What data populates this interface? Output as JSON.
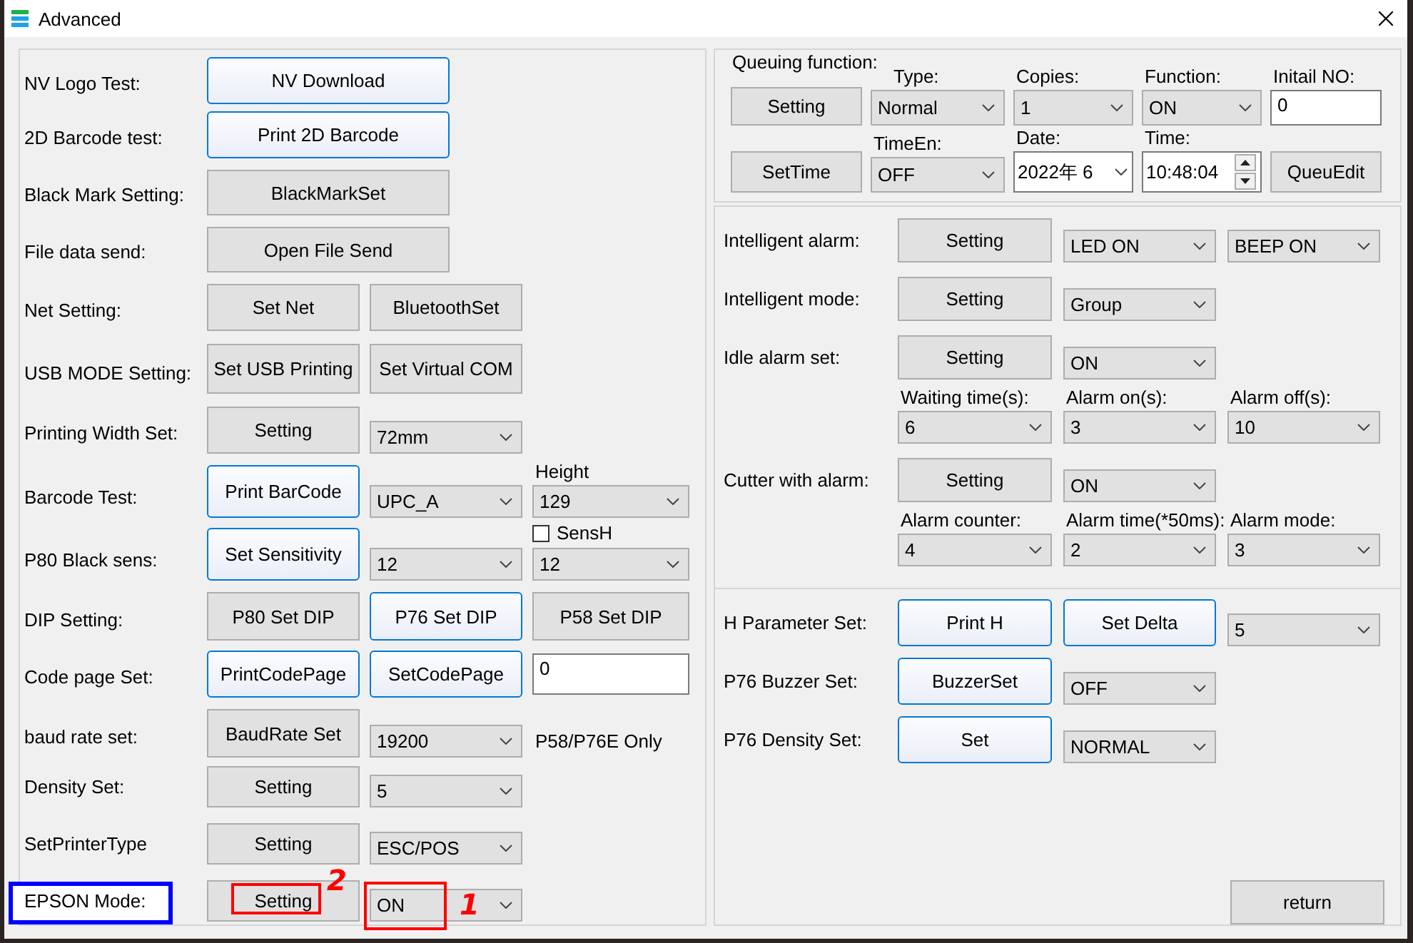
{
  "window": {
    "title": "Advanced"
  },
  "left_panel": {
    "rows": [
      {
        "label": "NV Logo Test:",
        "controls": [
          {
            "kind": "button",
            "label": "NV Download",
            "highlighted": true
          }
        ]
      },
      {
        "label": "2D Barcode test:",
        "controls": [
          {
            "kind": "button",
            "label": "Print 2D Barcode",
            "highlighted": true
          }
        ]
      },
      {
        "label": "Black Mark Setting:",
        "controls": [
          {
            "kind": "button",
            "label": "BlackMarkSet",
            "highlighted": false
          }
        ]
      },
      {
        "label": "File data send:",
        "controls": [
          {
            "kind": "button",
            "label": "Open File Send",
            "highlighted": false
          }
        ]
      },
      {
        "label": "Net Setting:",
        "controls": [
          {
            "kind": "button",
            "label": "Set Net",
            "highlighted": false
          },
          {
            "kind": "button",
            "label": "BluetoothSet",
            "highlighted": false
          }
        ]
      },
      {
        "label": "USB MODE Setting:",
        "controls": [
          {
            "kind": "button",
            "label": "Set USB Printing",
            "highlighted": false
          },
          {
            "kind": "button",
            "label": "Set Virtual COM",
            "highlighted": false
          }
        ]
      },
      {
        "label": "Printing Width Set:",
        "controls": [
          {
            "kind": "button",
            "label": "Setting",
            "highlighted": false
          },
          {
            "kind": "select",
            "value": "72mm"
          }
        ]
      },
      {
        "label": "Barcode Test:",
        "controls": [
          {
            "kind": "button",
            "label": "Print BarCode",
            "highlighted": true
          },
          {
            "kind": "select",
            "value": "UPC_A"
          },
          {
            "kind": "select",
            "caption": "Height",
            "value": "129"
          }
        ]
      },
      {
        "label": "P80 Black sens:",
        "controls": [
          {
            "kind": "button",
            "label": "Set Sensitivity",
            "highlighted": true
          },
          {
            "kind": "select",
            "value": "12"
          },
          {
            "kind": "select",
            "checkbox": {
              "label": "SensH",
              "checked": false
            },
            "value": "12"
          }
        ]
      },
      {
        "label": "DIP Setting:",
        "controls": [
          {
            "kind": "button",
            "label": "P80 Set DIP",
            "highlighted": false
          },
          {
            "kind": "button",
            "label": "P76 Set DIP",
            "highlighted": true
          },
          {
            "kind": "button",
            "label": "P58 Set DIP",
            "highlighted": false
          }
        ]
      },
      {
        "label": "Code page Set:",
        "controls": [
          {
            "kind": "button",
            "label": "PrintCodePage",
            "highlighted": true
          },
          {
            "kind": "button",
            "label": "SetCodePage",
            "highlighted": true
          },
          {
            "kind": "input",
            "value": "0"
          }
        ]
      },
      {
        "label": "baud rate set:",
        "controls": [
          {
            "kind": "button",
            "label": "BaudRate Set",
            "highlighted": false
          },
          {
            "kind": "select",
            "value": "19200"
          },
          {
            "kind": "note",
            "text": "P58/P76E Only"
          }
        ]
      },
      {
        "label": "Density Set:",
        "controls": [
          {
            "kind": "button",
            "label": "Setting",
            "highlighted": false
          },
          {
            "kind": "select",
            "value": "5"
          }
        ]
      },
      {
        "label": "SetPrinterType",
        "controls": [
          {
            "kind": "button",
            "label": "Setting",
            "highlighted": false
          },
          {
            "kind": "select",
            "value": "ESC/POS"
          }
        ]
      },
      {
        "label": "EPSON Mode:",
        "label_annotation": {
          "color": "#0000ff"
        },
        "controls": [
          {
            "kind": "button",
            "label": "Setting",
            "highlighted": false,
            "annotation": {
              "color": "#ff0000",
              "number": "2"
            }
          },
          {
            "kind": "select",
            "value": "ON",
            "annotation": {
              "color": "#ff0000",
              "number": "1"
            }
          }
        ]
      }
    ]
  },
  "queue_panel": {
    "title": "Queuing function:",
    "rows": [
      {
        "controls": [
          {
            "kind": "button",
            "label": "Setting",
            "highlighted": false
          },
          {
            "kind": "select",
            "caption": "Type:",
            "value": "Normal"
          },
          {
            "kind": "select",
            "caption": "Copies:",
            "value": "1"
          },
          {
            "kind": "select",
            "caption": "Function:",
            "value": "ON"
          },
          {
            "kind": "input",
            "caption": "Initail NO:",
            "value": "0"
          }
        ]
      },
      {
        "controls": [
          {
            "kind": "button",
            "label": "SetTime",
            "highlighted": false
          },
          {
            "kind": "select",
            "caption": "TimeEn:",
            "value": "OFF"
          },
          {
            "kind": "date",
            "caption": "Date:",
            "value": "2022年 6"
          },
          {
            "kind": "time",
            "caption": "Time:",
            "value": "10:48:04"
          },
          {
            "kind": "button",
            "label": "QueuEdit",
            "highlighted": false
          }
        ]
      }
    ]
  },
  "alarm_panel": {
    "rows": [
      {
        "label": "Intelligent alarm:",
        "controls": [
          {
            "kind": "button",
            "label": "Setting",
            "highlighted": false
          },
          {
            "kind": "select",
            "value": "LED ON"
          },
          {
            "kind": "select",
            "value": "BEEP ON"
          }
        ]
      },
      {
        "label": "Intelligent mode:",
        "controls": [
          {
            "kind": "button",
            "label": "Setting",
            "highlighted": false
          },
          {
            "kind": "select",
            "value": "Group"
          }
        ]
      },
      {
        "label": "Idle alarm set:",
        "controls": [
          {
            "kind": "button",
            "label": "Setting",
            "highlighted": false
          },
          {
            "kind": "select",
            "value": "ON"
          }
        ],
        "sub": [
          {
            "kind": "select",
            "caption": "Waiting time(s):",
            "value": "6"
          },
          {
            "kind": "select",
            "caption": "Alarm on(s):",
            "value": "3"
          },
          {
            "kind": "select",
            "caption": "Alarm off(s):",
            "value": "10"
          }
        ]
      },
      {
        "label": "Cutter with alarm:",
        "controls": [
          {
            "kind": "button",
            "label": "Setting",
            "highlighted": false
          },
          {
            "kind": "select",
            "value": "ON"
          }
        ],
        "sub": [
          {
            "kind": "select",
            "caption": "Alarm counter:",
            "value": "4"
          },
          {
            "kind": "select",
            "caption": "Alarm time(*50ms):",
            "value": "2"
          },
          {
            "kind": "select",
            "caption": "Alarm mode:",
            "value": "3"
          }
        ]
      }
    ]
  },
  "parameter_panel": {
    "rows": [
      {
        "label": "H Parameter Set:",
        "controls": [
          {
            "kind": "button",
            "label": "Print H",
            "highlighted": true
          },
          {
            "kind": "button",
            "label": "Set Delta",
            "highlighted": true
          },
          {
            "kind": "select",
            "value": "5"
          }
        ]
      },
      {
        "label": "P76 Buzzer Set:",
        "controls": [
          {
            "kind": "button",
            "label": "BuzzerSet",
            "highlighted": true
          },
          {
            "kind": "select",
            "value": "OFF"
          }
        ]
      },
      {
        "label": "P76 Density Set:",
        "controls": [
          {
            "kind": "button",
            "label": "Set",
            "highlighted": true
          },
          {
            "kind": "select",
            "value": "NORMAL"
          }
        ]
      }
    ],
    "footer": {
      "kind": "button",
      "label": "return",
      "highlighted": false
    }
  }
}
